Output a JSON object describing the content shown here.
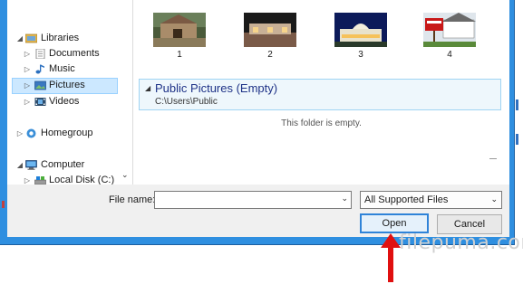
{
  "nav": {
    "items": [
      {
        "label": "Libraries",
        "arrow": "◢",
        "icon": "libraries-icon"
      },
      {
        "label": "Documents",
        "arrow": "▷",
        "icon": "documents-icon"
      },
      {
        "label": "Music",
        "arrow": "▷",
        "icon": "music-icon"
      },
      {
        "label": "Pictures",
        "arrow": "▷",
        "icon": "pictures-icon",
        "selected": true
      },
      {
        "label": "Videos",
        "arrow": "▷",
        "icon": "videos-icon"
      },
      {
        "label": "Homegroup",
        "arrow": "▷",
        "icon": "homegroup-icon"
      },
      {
        "label": "Computer",
        "arrow": "◢",
        "icon": "computer-icon"
      },
      {
        "label": "Local Disk (C:)",
        "arrow": "▷",
        "icon": "disk-icon"
      }
    ],
    "scroll_down": "⌄"
  },
  "thumbnails": [
    {
      "label": "1"
    },
    {
      "label": "2"
    },
    {
      "label": "3"
    },
    {
      "label": "4"
    }
  ],
  "group": {
    "title": "Public Pictures (Empty)",
    "path": "C:\\Users\\Public",
    "arrow": "◢"
  },
  "empty_message": "This folder is empty.",
  "file_name": {
    "label": "File name:",
    "value": "",
    "dropdown": "⌄"
  },
  "filter": {
    "selected": "All Supported Files",
    "dropdown": "⌄"
  },
  "buttons": {
    "open": "Open",
    "cancel": "Cancel"
  },
  "watermark": "filepuma.com",
  "colors": {
    "frame": "#2f8fe0",
    "selection": "#cce8ff",
    "accent_arrow": "#e01010"
  }
}
